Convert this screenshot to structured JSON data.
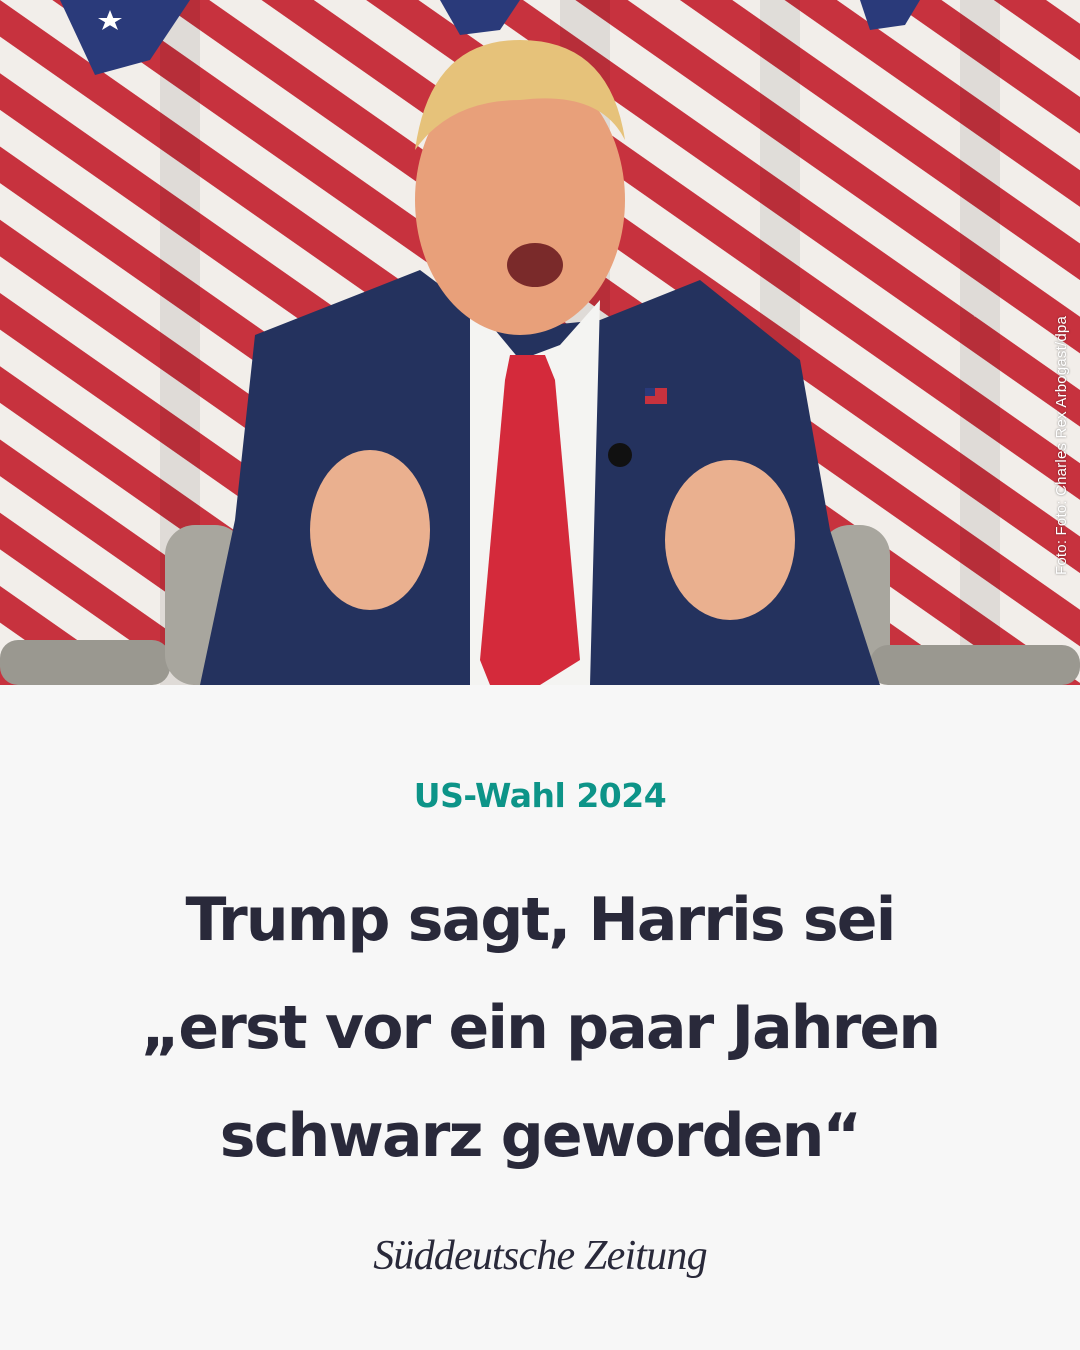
{
  "photo": {
    "alt_subject": "man-in-suit-gesturing-before-us-flag",
    "credit": "Foto: Foto: Charles Rex Arbogast/dpa"
  },
  "article": {
    "kicker": "US-Wahl 2024",
    "headline_lines": [
      "Trump sagt, Harris sei",
      "„erst vor ein paar Jahren",
      "schwarz geworden“"
    ]
  },
  "brand": {
    "name": "Süddeutsche Zeitung"
  },
  "colors": {
    "kicker": "#0d9488",
    "headline": "#29293a",
    "background": "#f7f7f7"
  }
}
